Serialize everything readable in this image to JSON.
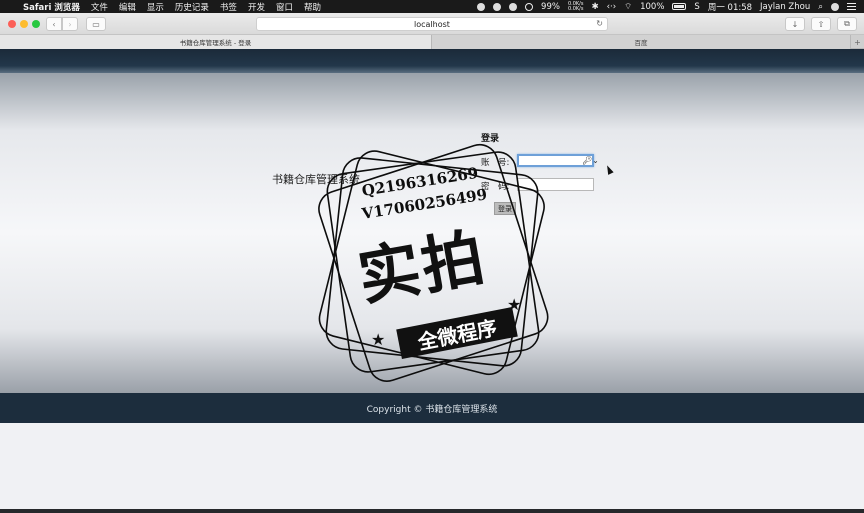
{
  "menubar": {
    "app_name": "Safari 浏览器",
    "menus": [
      "文件",
      "编辑",
      "显示",
      "历史记录",
      "书签",
      "开发",
      "窗口",
      "帮助"
    ],
    "battery_percent": "99%",
    "net_up": "0.0K/s",
    "net_down": "0.0K/s",
    "battery2": "100%",
    "clock": "周一 01:58",
    "user": "Jaylan Zhou"
  },
  "toolbar": {
    "address": "localhost"
  },
  "tabs": [
    {
      "label": "书籍仓库管理系统 - 登录"
    },
    {
      "label": "百度"
    }
  ],
  "page": {
    "system_name": "书籍仓库管理系统",
    "login_title": "登录",
    "account_label": "账　号:",
    "password_label": "密　码:",
    "account_value": "",
    "password_value": "",
    "login_button": "登录",
    "footer": "Copyright © 书籍仓库管理系统"
  },
  "watermark": {
    "line1": "Q2196316269",
    "line2": "V17060256499",
    "big": "实拍",
    "banner": "全微程序"
  },
  "colors": {
    "header_dark": "#1c2d3d",
    "input_focus": "#6ea0d8"
  }
}
